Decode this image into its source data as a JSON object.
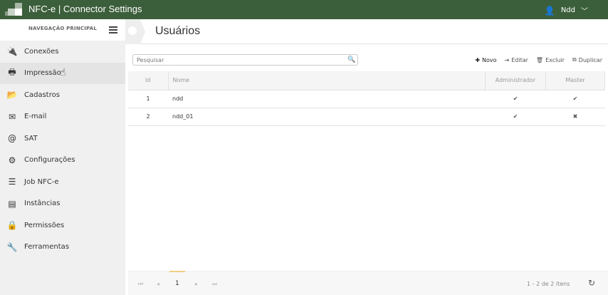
{
  "header": {
    "title": "NFC-e | Connector Settings",
    "user": "Ndd",
    "brand_color": "#3c5f3b"
  },
  "sidebar": {
    "heading": "NAVEGAÇÃO PRINCIPAL",
    "items": [
      {
        "label": "Conexões",
        "icon": "plug-icon",
        "glyph": "🔌"
      },
      {
        "label": "Impressão",
        "icon": "printer-icon",
        "glyph": "🖶"
      },
      {
        "label": "Cadastros",
        "icon": "folder-open-icon",
        "glyph": "📂"
      },
      {
        "label": "E-mail",
        "icon": "envelope-icon",
        "glyph": "✉"
      },
      {
        "label": "SAT",
        "icon": "at-icon",
        "glyph": "@"
      },
      {
        "label": "Configurações",
        "icon": "gear-icon",
        "glyph": "⚙"
      },
      {
        "label": "Job NFC-e",
        "icon": "sliders-icon",
        "glyph": "☰"
      },
      {
        "label": "Instâncias",
        "icon": "server-icon",
        "glyph": "▤"
      },
      {
        "label": "Permissões",
        "icon": "lock-icon",
        "glyph": "🔒"
      },
      {
        "label": "Ferramentas",
        "icon": "wrench-icon",
        "glyph": "🔧"
      }
    ]
  },
  "main": {
    "title": "Usuários",
    "search_placeholder": "Pesquisar",
    "toolbar": {
      "novo": "Novo",
      "editar": "Editar",
      "excluir": "Excluir",
      "duplicar": "Duplicar"
    },
    "columns": [
      "Id",
      "Nome",
      "Administrador",
      "Master"
    ],
    "rows": [
      {
        "id": "1",
        "nome": "ndd",
        "admin": "✔",
        "master": "✔"
      },
      {
        "id": "2",
        "nome": "ndd_01",
        "admin": "✔",
        "master": "✖"
      }
    ],
    "pager": {
      "page": "1",
      "summary": "1 - 2 de 2 itens"
    }
  }
}
